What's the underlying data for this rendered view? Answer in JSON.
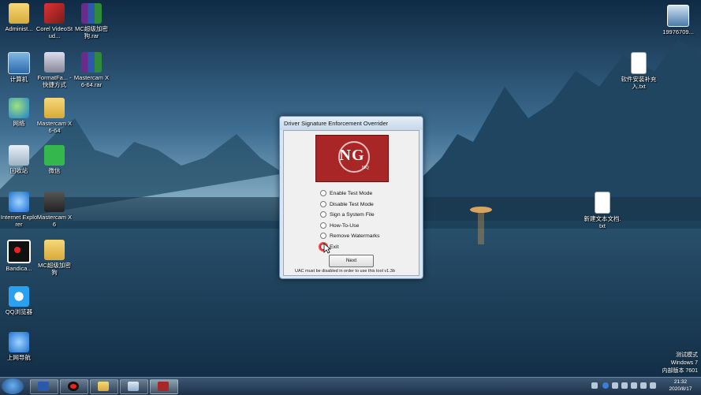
{
  "desktop": {
    "icons_left": [
      {
        "label": "Administ...",
        "icon": "folder-icon"
      },
      {
        "label": "计算机",
        "icon": "computer-icon"
      },
      {
        "label": "网络",
        "icon": "network-icon"
      },
      {
        "label": "回收站",
        "icon": "recycle-bin-icon"
      },
      {
        "label": "Internet Explorer",
        "icon": "ie-icon"
      },
      {
        "label": "Bandica...",
        "icon": "bandicam-icon"
      },
      {
        "label": "QQ浏览器",
        "icon": "qq-browser-icon"
      },
      {
        "label": "上网导航",
        "icon": "ie-icon"
      }
    ],
    "icons_col2": [
      {
        "label": "Corel VideoStud...",
        "icon": "corel-icon"
      },
      {
        "label": "FormatFa... - 快捷方式",
        "icon": "shortcut-icon"
      },
      {
        "label": "Mastercam X6-64",
        "icon": "folder-icon"
      },
      {
        "label": "微信",
        "icon": "wechat-icon"
      },
      {
        "label": "Mastercam X6",
        "icon": "mastercam-icon"
      },
      {
        "label": "MC超级加密狗",
        "icon": "folder-icon"
      }
    ],
    "icons_col3": [
      {
        "label": "MC超级加密狗.rar",
        "icon": "rar-icon"
      },
      {
        "label": "Mastercam X6-64.rar",
        "icon": "rar-icon"
      }
    ],
    "icons_right": [
      {
        "label": "19976709...",
        "icon": "screenshot-icon"
      },
      {
        "label": "软件安装补充入.txt",
        "icon": "text-file-icon"
      },
      {
        "label": "新建文本文档.txt",
        "icon": "text-file-icon"
      }
    ]
  },
  "dialog": {
    "title": "Driver Signature Enforcement Overrider",
    "logo_text": "NG",
    "logo_sub": "HQ",
    "options": [
      "Enable Test Mode",
      "Disable Test Mode",
      "Sign a System File",
      "How-To-Use",
      "Remove Watermarks",
      "Exit"
    ],
    "next_label": "Next",
    "status_text": "UAC must be disabled in order to use this tool   v1.3b"
  },
  "watermark": {
    "line1": "测试模式",
    "line2": "Windows 7",
    "line3": "内部版本 7601"
  },
  "taskbar": {
    "time": "21:32",
    "date": "2020/8/17",
    "pinned": [
      "windows-explorer-icon",
      "bandicam-icon",
      "folder-icon",
      "notepad-icon",
      "ng-dseo-icon"
    ]
  }
}
